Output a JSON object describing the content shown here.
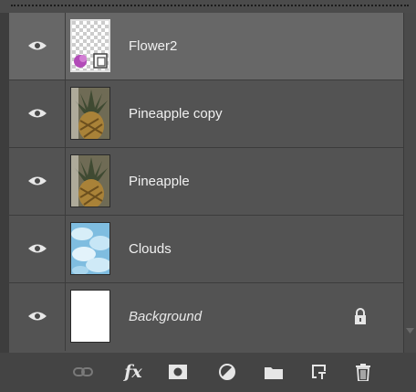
{
  "layers": [
    {
      "name": "Flower2",
      "visible": true,
      "selected": true,
      "thumbnail": "smart-object-transparent",
      "italic": false
    },
    {
      "name": "Pineapple copy",
      "visible": true,
      "selected": false,
      "thumbnail": "pineapple",
      "italic": false
    },
    {
      "name": "Pineapple",
      "visible": true,
      "selected": false,
      "thumbnail": "pineapple",
      "italic": false
    },
    {
      "name": "Clouds",
      "visible": true,
      "selected": false,
      "thumbnail": "clouds",
      "italic": false
    },
    {
      "name": "Background",
      "visible": true,
      "selected": false,
      "thumbnail": "white",
      "italic": true,
      "locked": true
    }
  ],
  "footer": {
    "buttons": [
      "link-layers-icon",
      "fx-icon",
      "layer-mask-icon",
      "adjustment-layer-icon",
      "group-folder-icon",
      "new-layer-icon",
      "trash-icon"
    ],
    "fx_label": "fx"
  },
  "colors": {
    "panel": "#535353",
    "selected_row": "#676767",
    "footer": "#444444",
    "text": "#f0f0f0"
  }
}
